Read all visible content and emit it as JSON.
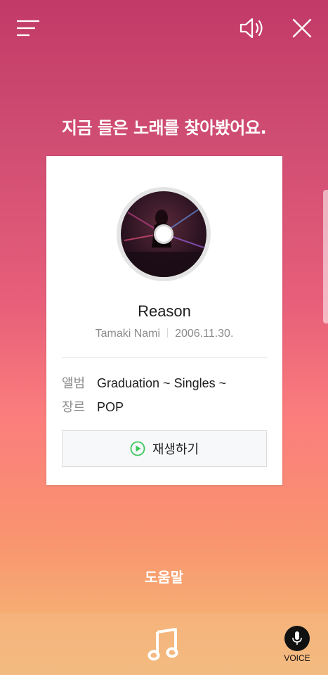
{
  "headline": "지금 들은 노래를 찾아봤어요.",
  "song": {
    "title": "Reason",
    "artist": "Tamaki Nami",
    "release_date": "2006.11.30."
  },
  "info": {
    "album_label": "앨범",
    "album_value": "Graduation  ~ Singles ~",
    "genre_label": "장르",
    "genre_value": "POP"
  },
  "play_button_label": "재생하기",
  "help_label": "도움말",
  "voice_label": "VOICE",
  "icons": {
    "menu": "menu-icon",
    "sound": "speaker-icon",
    "close": "close-icon",
    "play": "play-circle-icon",
    "music": "music-note-icon",
    "mic": "microphone-icon"
  },
  "colors": {
    "play_accent": "#3cc85a",
    "voice_button": "#111111"
  }
}
